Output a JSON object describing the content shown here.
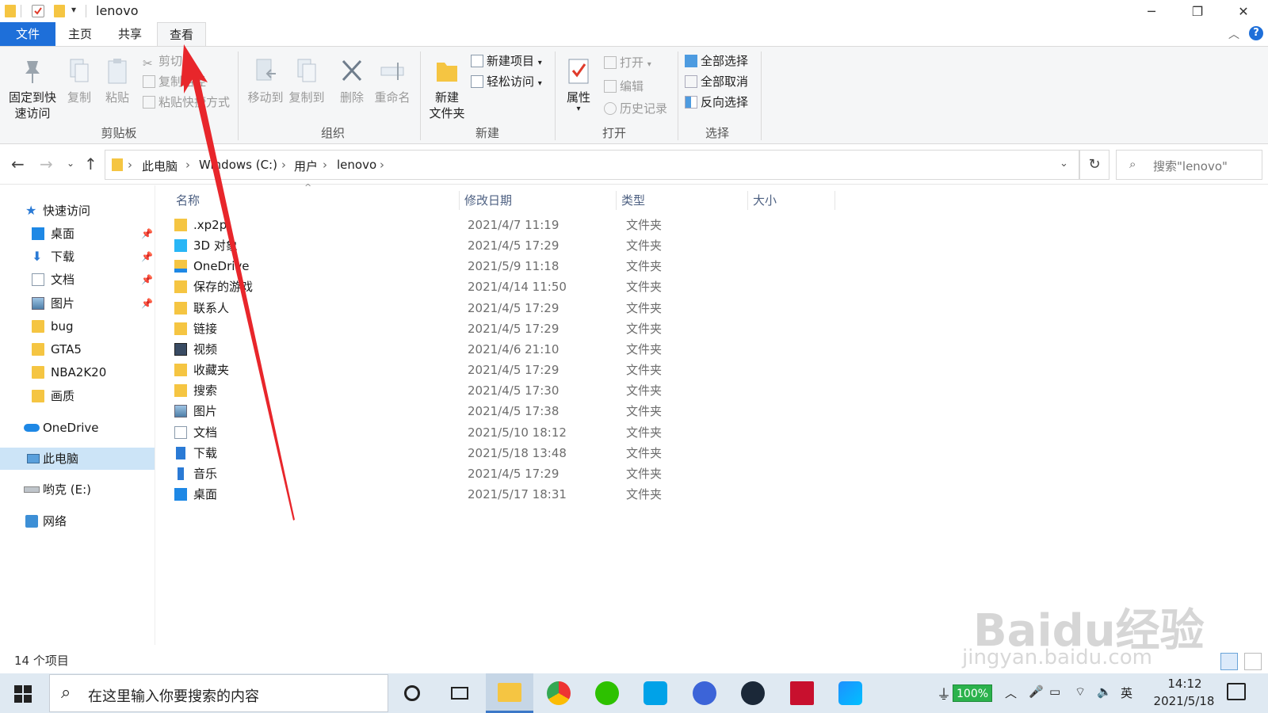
{
  "window": {
    "title": "lenovo",
    "controls": {
      "minimize": "─",
      "maximize": "❐",
      "close": "✕"
    },
    "help": "?"
  },
  "tabs": [
    {
      "label": "文件"
    },
    {
      "label": "主页"
    },
    {
      "label": "共享"
    },
    {
      "label": "查看"
    }
  ],
  "ribbon": {
    "clipboard": {
      "pin_label_1": "固定到快",
      "pin_label_2": "速访问",
      "copy": "复制",
      "paste": "粘贴",
      "cut": "剪切",
      "copy_path": "复制路径",
      "paste_shortcut": "粘贴快捷方式",
      "group": "剪贴板"
    },
    "organize": {
      "move_to": "移动到",
      "copy_to": "复制到",
      "delete": "删除",
      "rename": "重命名",
      "group": "组织"
    },
    "new": {
      "new_folder_1": "新建",
      "new_folder_2": "文件夹",
      "new_item": "新建项目",
      "easy_access": "轻松访问",
      "group": "新建"
    },
    "open": {
      "properties": "属性",
      "open": "打开",
      "edit": "编辑",
      "history": "历史记录",
      "group": "打开"
    },
    "select": {
      "select_all": "全部选择",
      "select_none": "全部取消",
      "invert": "反向选择",
      "group": "选择"
    }
  },
  "address": {
    "crumbs": [
      "此电脑",
      "Windows (C:)",
      "用户",
      "lenovo"
    ],
    "search_placeholder": "搜索\"lenovo\""
  },
  "nav": {
    "quick_access": "快速访问",
    "pinned": [
      {
        "label": "桌面"
      },
      {
        "label": "下载"
      },
      {
        "label": "文档"
      },
      {
        "label": "图片"
      }
    ],
    "folders": [
      {
        "label": "bug"
      },
      {
        "label": "GTA5"
      },
      {
        "label": "NBA2K20"
      },
      {
        "label": "画质"
      }
    ],
    "onedrive": "OneDrive",
    "this_pc": "此电脑",
    "drive_e": "哟克 (E:)",
    "network": "网络"
  },
  "columns": {
    "name": "名称",
    "modified": "修改日期",
    "type": "类型",
    "size": "大小"
  },
  "files": [
    {
      "name": ".xp2p",
      "date": "2021/4/7 11:19",
      "type": "文件夹",
      "icon": "folder-icon"
    },
    {
      "name": "3D 对象",
      "date": "2021/4/5 17:29",
      "type": "文件夹",
      "icon": "3d-objects-icon"
    },
    {
      "name": "OneDrive",
      "date": "2021/5/9 11:18",
      "type": "文件夹",
      "icon": "onedrive-folder-icon"
    },
    {
      "name": "保存的游戏",
      "date": "2021/4/14 11:50",
      "type": "文件夹",
      "icon": "saved-games-icon"
    },
    {
      "name": "联系人",
      "date": "2021/4/5 17:29",
      "type": "文件夹",
      "icon": "contacts-icon"
    },
    {
      "name": "链接",
      "date": "2021/4/5 17:29",
      "type": "文件夹",
      "icon": "links-icon"
    },
    {
      "name": "视频",
      "date": "2021/4/6 21:10",
      "type": "文件夹",
      "icon": "videos-icon"
    },
    {
      "name": "收藏夹",
      "date": "2021/4/5 17:29",
      "type": "文件夹",
      "icon": "favorites-icon"
    },
    {
      "name": "搜索",
      "date": "2021/4/5 17:30",
      "type": "文件夹",
      "icon": "searches-icon"
    },
    {
      "name": "图片",
      "date": "2021/4/5 17:38",
      "type": "文件夹",
      "icon": "pictures-icon"
    },
    {
      "name": "文档",
      "date": "2021/5/10 18:12",
      "type": "文件夹",
      "icon": "documents-icon"
    },
    {
      "name": "下载",
      "date": "2021/5/18 13:48",
      "type": "文件夹",
      "icon": "downloads-icon"
    },
    {
      "name": "音乐",
      "date": "2021/4/5 17:29",
      "type": "文件夹",
      "icon": "music-icon"
    },
    {
      "name": "桌面",
      "date": "2021/5/17 18:31",
      "type": "文件夹",
      "icon": "desktop-icon"
    }
  ],
  "status": {
    "count": "14 个项目"
  },
  "taskbar": {
    "search_placeholder": "在这里输入你要搜索的内容",
    "battery": "100%",
    "ime": "英",
    "time": "14:12",
    "date": "2021/5/18"
  },
  "watermark": {
    "brand": "Baidu经验",
    "url": "jingyan.baidu.com"
  },
  "colors": {
    "accent": "#1e6fd9",
    "annotation_arrow": "#e8262b",
    "selected": "#cce4f7",
    "folder": "#f5c542"
  }
}
